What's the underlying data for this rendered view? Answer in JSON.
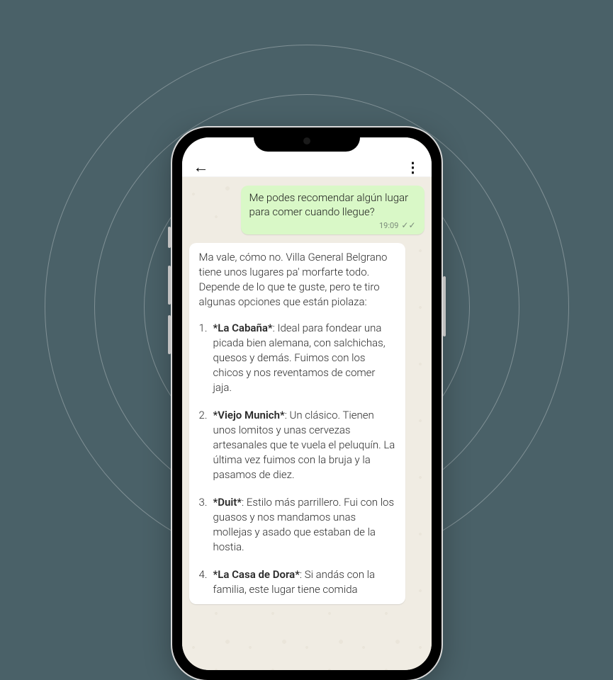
{
  "sent_message": {
    "text": "Me podes recomendar algún lugar para comer cuando llegue?",
    "time": "19:09"
  },
  "received_message": {
    "intro": "Ma vale, cómo no. Villa General Belgrano tiene unos lugares pa' morfarte todo. Depende de lo que te guste, pero te tiro algunas opciones que están piolaza:",
    "items": [
      {
        "name": "*La Cabaña*",
        "desc": ": Ideal para fondear una picada bien alemana, con salchichas, quesos y demás. Fuimos con los chicos y nos reventamos de comer jaja."
      },
      {
        "name": "*Viejo Munich*",
        "desc": ": Un clásico. Tienen unos lomitos y unas cervezas artesanales que te vuela el peluquín. La última vez fuimos con la bruja y la pasamos de diez."
      },
      {
        "name": "*Duit*",
        "desc": ": Estilo más parrillero. Fui con los guasos y nos mandamos unas mollejas y asado que estaban de la hostia."
      },
      {
        "name": "*La Casa de Dora*",
        "desc": ": Si andás con la familia, este lugar tiene comida"
      }
    ]
  }
}
